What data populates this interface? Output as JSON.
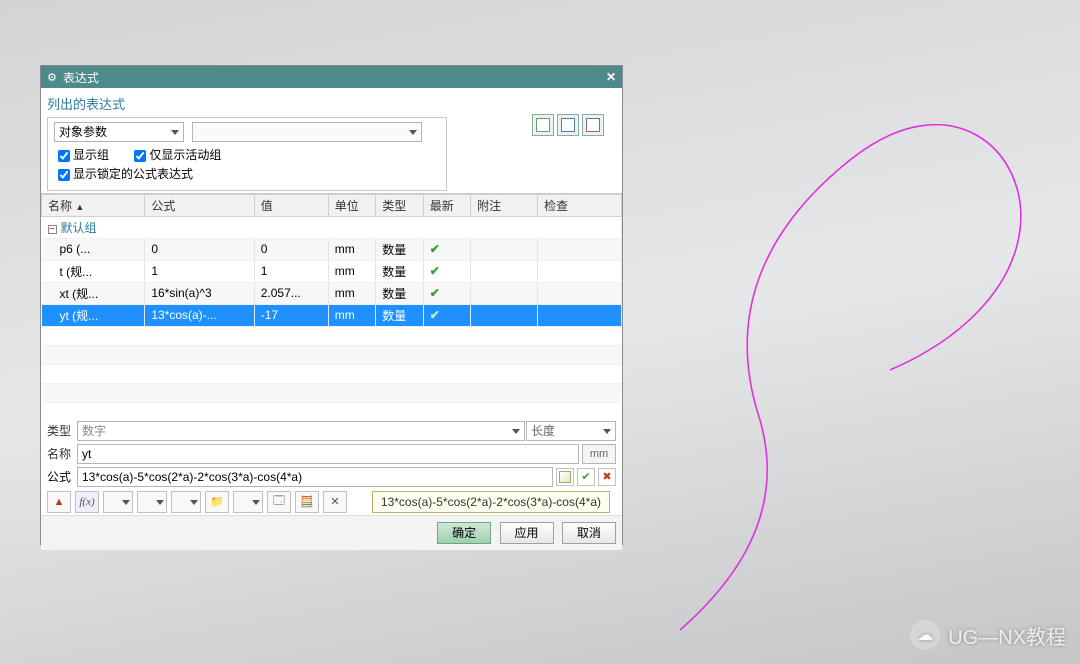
{
  "dialog": {
    "title": "表达式",
    "sectionTitle": "列出的表达式",
    "dropdown1": "对象参数",
    "dropdown2": "",
    "checkbox1": "显示组",
    "checkbox2": "仅显示活动组",
    "checkbox3": "显示锁定的公式表达式"
  },
  "columns": {
    "name": "名称",
    "formula": "公式",
    "value": "值",
    "unit": "单位",
    "type": "类型",
    "latest": "最新",
    "note": "附注",
    "check": "检查"
  },
  "groupName": "默认组",
  "rows": [
    {
      "name": "p6 (...",
      "formula": "0",
      "value": "0",
      "unit": "mm",
      "type": "数量",
      "latest": "✔"
    },
    {
      "name": "t (规...",
      "formula": "1",
      "value": "1",
      "unit": "mm",
      "type": "数量",
      "latest": "✔"
    },
    {
      "name": "xt (规...",
      "formula": "16*sin(a)^3",
      "value": "2.057...",
      "unit": "mm",
      "type": "数量",
      "latest": "✔"
    },
    {
      "name": "yt (规...",
      "formula": "13*cos(a)-...",
      "value": "-17",
      "unit": "mm",
      "type": "数量",
      "latest": "✔"
    }
  ],
  "form": {
    "typeLabel": "类型",
    "typeValue": "数字",
    "typeRight": "长度",
    "nameLabel": "名称",
    "nameValue": "yt",
    "nameUnit": "mm",
    "formulaLabel": "公式",
    "formulaValue": "13*cos(a)-5*cos(2*a)-2*cos(3*a)-cos(4*a)",
    "tooltip": "13*cos(a)-5*cos(2*a)-2*cos(3*a)-cos(4*a)"
  },
  "buttons": {
    "ok": "确定",
    "apply": "应用",
    "cancel": "取消"
  },
  "watermark": "UG—NX教程"
}
